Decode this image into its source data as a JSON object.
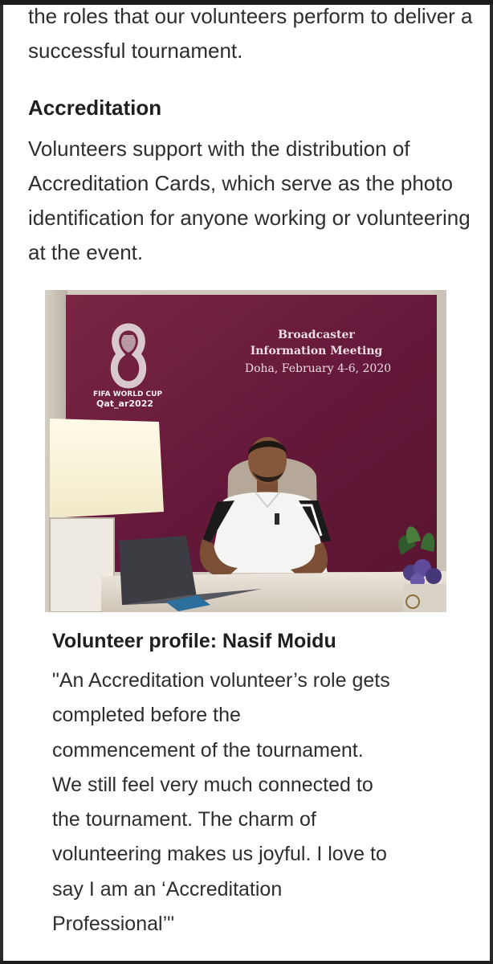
{
  "intro_text": "the roles that our volunteers perform to deliver a successful tournament.",
  "section": {
    "heading": "Accreditation",
    "body": "Volunteers support with the distribution of Accreditation Cards, which serve as the photo identification for anyone working or volunteering at the event."
  },
  "photo": {
    "backdrop": {
      "line1": "Broadcaster",
      "line2": "Information Meeting",
      "line3": "Doha, February 4-6, 2020"
    },
    "logo": {
      "line1": "FIFA WORLD CUP",
      "line2": "Qat_ar2022"
    },
    "backdrop_color": "#6b1f3a"
  },
  "profile": {
    "title": "Volunteer profile: Nasif Moidu",
    "quote_lines": [
      "\"An Accreditation volunteer’s role gets",
      "completed before the",
      "commencement of the tournament.",
      "We still feel very much connected to",
      "the tournament. The charm of",
      "volunteering makes us joyful. I love to",
      "say I am an ‘Accreditation",
      "Professional’\""
    ]
  }
}
